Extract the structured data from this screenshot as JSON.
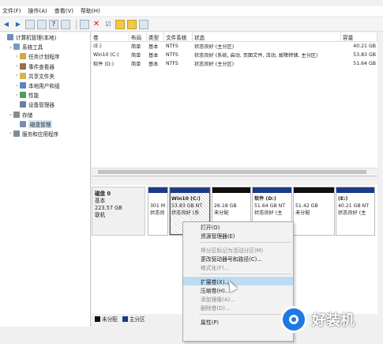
{
  "menu": [
    "文件(F)",
    "操作(A)",
    "查看(V)",
    "帮助(H)"
  ],
  "toolbar_icons": [
    "back-arrow-icon",
    "forward-arrow-icon",
    "folder-icon",
    "list-icon",
    "help-icon",
    "list-view-icon",
    "properties-icon",
    "delete-icon",
    "check-icon",
    "new-icon",
    "open-icon",
    "view-icon"
  ],
  "tree": [
    {
      "label": "计算机管理(本地)",
      "exp": "",
      "color": "#6c8ebf"
    },
    {
      "label": "系统工具",
      "exp": "⌄",
      "color": "#7a9ac2"
    },
    {
      "label": "任务计划程序",
      "exp": "›",
      "color": "#d9a441"
    },
    {
      "label": "事件查看器",
      "exp": "›",
      "color": "#9b6b4a"
    },
    {
      "label": "共享文件夹",
      "exp": "›",
      "color": "#d9b441"
    },
    {
      "label": "本地用户和组",
      "exp": "›",
      "color": "#5a86c4"
    },
    {
      "label": "性能",
      "exp": "›",
      "color": "#4aa05a"
    },
    {
      "label": "设备管理器",
      "exp": "",
      "color": "#6a7fa0"
    },
    {
      "label": "存储",
      "exp": "⌄",
      "color": "#8a8a8a"
    },
    {
      "label": "磁盘管理",
      "exp": "",
      "color": "#7a8da8"
    },
    {
      "label": "服务和应用程序",
      "exp": "›",
      "color": "#7d8c9c"
    }
  ],
  "volume_table": {
    "headers": [
      "卷",
      "布局",
      "类型",
      "文件系统",
      "状态",
      "容量"
    ],
    "rows": [
      [
        "(E:)",
        "简单",
        "基本",
        "NTFS",
        "状态良好 (主分区)",
        "40.21 GB"
      ],
      [
        "Win10 (C:)",
        "简单",
        "基本",
        "NTFS",
        "状态良好 (系统, 启动, 页面文件, 活动, 故障转储, 主分区)",
        "53.83 GB"
      ],
      [
        "软件 (D:)",
        "简单",
        "基本",
        "NTFS",
        "状态良好 (主分区)",
        "51.64 GB"
      ]
    ]
  },
  "disk": {
    "name": "磁盘 0",
    "type": "基本",
    "size": "223.57 GB",
    "status": "联机"
  },
  "partitions": [
    {
      "line1": "301 M",
      "line2": "状态良",
      "bar": "#1a3a8a",
      "title": ""
    },
    {
      "title": "Win10 (C:)",
      "line1": "53.83 GB NT",
      "line2": "状态良好 (系",
      "bar": "#1a3a8a"
    },
    {
      "title": "",
      "line1": "26.18 GB",
      "line2": "未分配",
      "bar": "#111"
    },
    {
      "title": "软件 (D:)",
      "line1": "51.64 GB NT",
      "line2": "状态良好 (主",
      "bar": "#1a3a8a"
    },
    {
      "title": "",
      "line1": "51.42 GB",
      "line2": "未分配",
      "bar": "#111"
    },
    {
      "title": "(E:)",
      "line1": "40.21 GB NT",
      "line2": "状态良好 (主",
      "bar": "#1a3a8a"
    }
  ],
  "legend": {
    "unallocated": "未分配",
    "primary": "主分区",
    "unallocated_color": "#111",
    "primary_color": "#1a3a8a"
  },
  "context_menu": [
    {
      "label": "打开(O)",
      "state": "normal"
    },
    {
      "label": "资源管理器(E)",
      "state": "normal"
    },
    {
      "sep": true
    },
    {
      "label": "将分区标记为活动分区(M)",
      "state": "disabled"
    },
    {
      "label": "更改驱动器号和路径(C)...",
      "state": "normal"
    },
    {
      "label": "格式化(F)...",
      "state": "disabled"
    },
    {
      "sep": true
    },
    {
      "label": "扩展卷(X)...",
      "state": "highlight"
    },
    {
      "label": "压缩卷(H)...",
      "state": "normal"
    },
    {
      "label": "添加镜像(A)...",
      "state": "disabled"
    },
    {
      "label": "删除卷(D)...",
      "state": "disabled"
    },
    {
      "sep": true
    },
    {
      "label": "属性(P)",
      "state": "normal"
    }
  ],
  "watermark": "好装机"
}
